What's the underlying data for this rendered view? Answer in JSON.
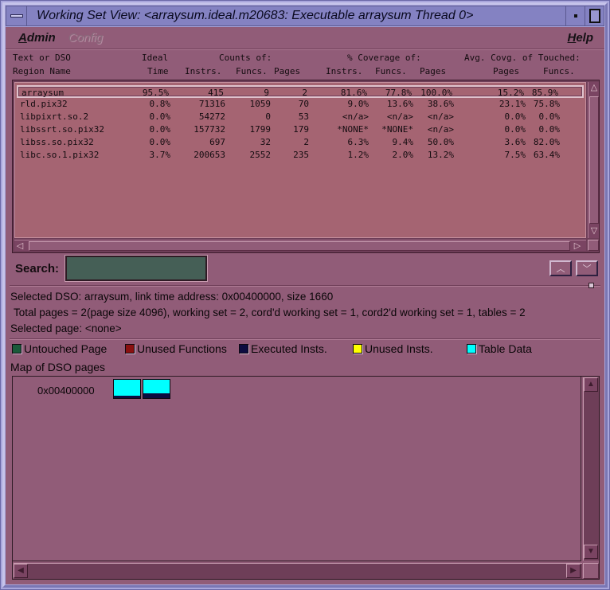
{
  "window": {
    "title": "Working Set View: <arraysum.ideal.m20683: Executable arraysum Thread 0>"
  },
  "menubar": {
    "admin": "Admin",
    "config": "Config",
    "help": "Help"
  },
  "table": {
    "header_line1": {
      "name": "Text or DSO",
      "ideal": "Ideal",
      "counts": "Counts of:",
      "coverage": "% Coverage of:",
      "avg": "Avg. Covg. of Touched:"
    },
    "header_line2": {
      "name": "Region Name",
      "time": "Time",
      "instrs": "Instrs.",
      "funcs": "Funcs.",
      "pages": "Pages",
      "cov_instrs": "Instrs.",
      "cov_funcs": "Funcs.",
      "cov_pages": "Pages",
      "avg_pages": "Pages",
      "avg_funcs": "Funcs."
    },
    "rows": [
      {
        "name": "arraysum",
        "time": "95.5%",
        "instrs": "415",
        "funcs": "9",
        "pages": "2",
        "cov_instrs": "81.6%",
        "cov_funcs": "77.8%",
        "cov_pages": "100.0%",
        "avg_pages": "15.2%",
        "avg_funcs": "85.9%"
      },
      {
        "name": "rld.pix32",
        "time": "0.8%",
        "instrs": "71316",
        "funcs": "1059",
        "pages": "70",
        "cov_instrs": "9.0%",
        "cov_funcs": "13.6%",
        "cov_pages": "38.6%",
        "avg_pages": "23.1%",
        "avg_funcs": "75.8%"
      },
      {
        "name": "libpixrt.so.2",
        "time": "0.0%",
        "instrs": "54272",
        "funcs": "0",
        "pages": "53",
        "cov_instrs": "<n/a>",
        "cov_funcs": "<n/a>",
        "cov_pages": "<n/a>",
        "avg_pages": "0.0%",
        "avg_funcs": "0.0%"
      },
      {
        "name": "libssrt.so.pix32",
        "time": "0.0%",
        "instrs": "157732",
        "funcs": "1799",
        "pages": "179",
        "cov_instrs": "*NONE*",
        "cov_funcs": "*NONE*",
        "cov_pages": "<n/a>",
        "avg_pages": "0.0%",
        "avg_funcs": "0.0%"
      },
      {
        "name": "libss.so.pix32",
        "time": "0.0%",
        "instrs": "697",
        "funcs": "32",
        "pages": "2",
        "cov_instrs": "6.3%",
        "cov_funcs": "9.4%",
        "cov_pages": "50.0%",
        "avg_pages": "3.6%",
        "avg_funcs": "82.0%"
      },
      {
        "name": "libc.so.1.pix32",
        "time": "3.7%",
        "instrs": "200653",
        "funcs": "2552",
        "pages": "235",
        "cov_instrs": "1.2%",
        "cov_funcs": "2.0%",
        "cov_pages": "13.2%",
        "avg_pages": "7.5%",
        "avg_funcs": "63.4%"
      }
    ]
  },
  "search": {
    "label": "Search:",
    "value": ""
  },
  "info": {
    "selected_dso": "Selected DSO: arraysum, link time address: 0x00400000, size 1660",
    "total_pages": "Total pages = 2(page size 4096), working set = 2, cord'd working set = 1, cord2'd working set = 1, tables = 2",
    "selected_page": "Selected page: <none>"
  },
  "legend": [
    {
      "label": "Untouched Page",
      "color": "#1a5a3a"
    },
    {
      "label": "Unused Functions",
      "color": "#8a1010"
    },
    {
      "label": "Executed Insts.",
      "color": "#0c0c40"
    },
    {
      "label": "Unused Insts.",
      "color": "#ffff00"
    },
    {
      "label": "Table Data",
      "color": "#00ffff"
    }
  ],
  "map": {
    "title": "Map of DSO pages",
    "address": "0x00400000",
    "pages": [
      {
        "type": "Table Data",
        "executed_fraction": 0.12
      },
      {
        "type": "Table Data",
        "executed_fraction": 0.25
      }
    ]
  },
  "icons": {
    "window_menu": "window-menu-icon",
    "minimize": "minimize-icon",
    "maximize": "maximize-icon",
    "search_up": "chevron-up-icon",
    "search_down": "chevron-down-icon"
  }
}
